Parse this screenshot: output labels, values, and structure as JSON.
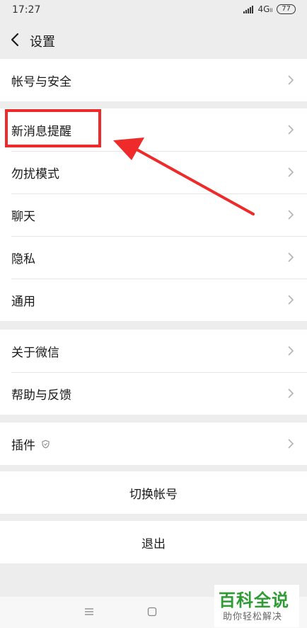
{
  "status": {
    "time": "17:27",
    "network": "4G",
    "network_suffix": "ll",
    "battery": "77"
  },
  "header": {
    "title": "设置"
  },
  "groups": [
    {
      "items": [
        {
          "label": "帐号与安全"
        }
      ]
    },
    {
      "items": [
        {
          "label": "新消息提醒"
        },
        {
          "label": "勿扰模式"
        },
        {
          "label": "聊天"
        },
        {
          "label": "隐私"
        },
        {
          "label": "通用"
        }
      ]
    },
    {
      "items": [
        {
          "label": "关于微信"
        },
        {
          "label": "帮助与反馈"
        }
      ]
    },
    {
      "items": [
        {
          "label": "插件"
        }
      ]
    }
  ],
  "actions": {
    "switch_account": "切换帐号",
    "logout": "退出"
  },
  "watermark": {
    "title": "百科全说",
    "subtitle": "助你轻松解决"
  },
  "colors": {
    "background": "#ededed",
    "highlight": "#ee2a2a",
    "watermark_green": "#2f9b35"
  }
}
